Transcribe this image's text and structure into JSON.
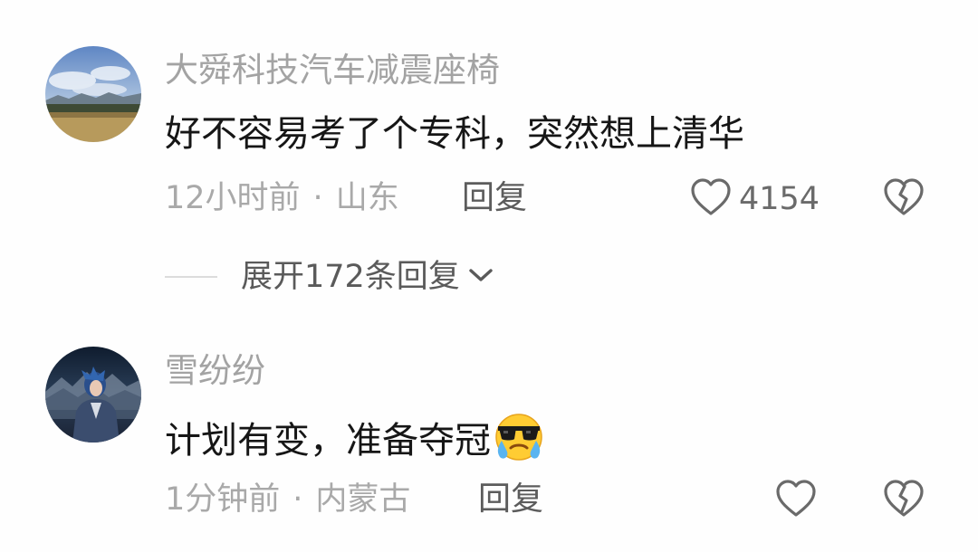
{
  "comments": [
    {
      "username": "大舜科技汽车减震座椅",
      "text": "好不容易考了个专科，突然想上清华",
      "time": "12小时前",
      "separator": "·",
      "location": "山东",
      "reply_label": "回复",
      "like_count": "4154",
      "expand_label": "展开172条回复"
    },
    {
      "username": "雪纷纷",
      "text": "计划有变，准备夺冠",
      "emoji": "cool-crying-emoji",
      "time": "1分钟前",
      "separator": "·",
      "location": "内蒙古",
      "reply_label": "回复"
    }
  ],
  "icons": {
    "like": "heart-outline-icon",
    "dislike": "broken-heart-icon",
    "expand": "chevron-down-icon"
  },
  "colors": {
    "background": "#fefefe",
    "username": "#a3a3a3",
    "text": "#161616",
    "meta": "#a9a9a9"
  }
}
